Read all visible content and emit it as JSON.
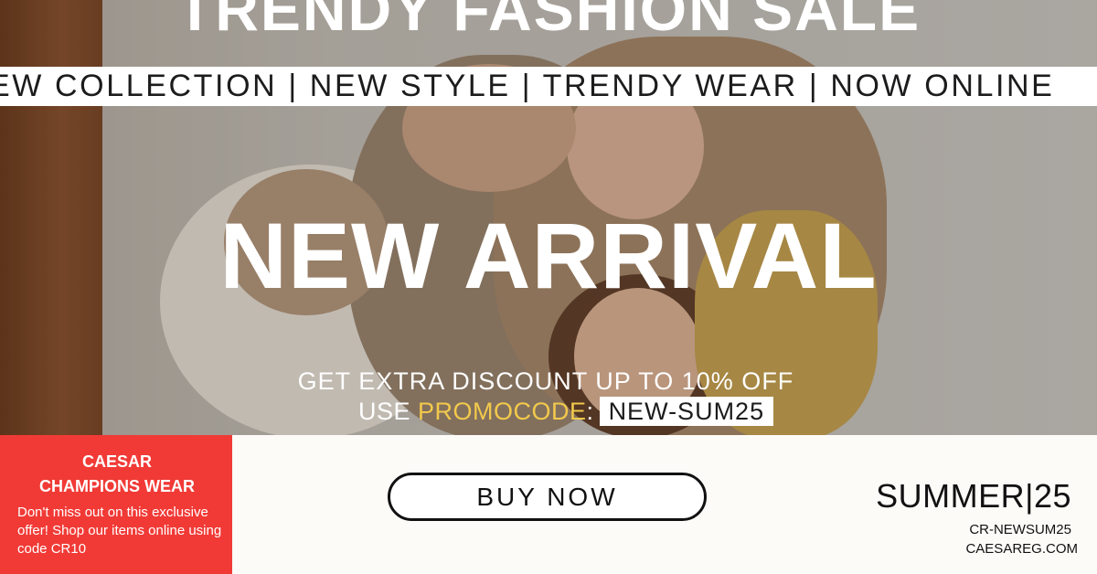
{
  "hero": {
    "top_title": "TRENDY FASHION SALE",
    "ticker": "EW COLLECTION | NEW STYLE | TRENDY WEAR | NOW ONLINE",
    "headline": "NEW ARRIVAL",
    "discount": "GET EXTRA DISCOUNT UP TO 10% OFF",
    "promo_prefix": "USE ",
    "promo_word": "PROMOCODE",
    "promo_colon": ":",
    "promo_code": "NEW-SUM25"
  },
  "brand": {
    "name_line1": "CAESAR",
    "name_line2": "CHAMPIONS WEAR",
    "text": "Don't miss out on this exclusive offer! Shop our items online using code CR10"
  },
  "cta": {
    "label": "BUY NOW"
  },
  "info": {
    "season": "SUMMER|25",
    "code": "CR-NEWSUM25",
    "website": "CAESAREG.COM"
  },
  "colors": {
    "brand_red": "#f13a36",
    "promo_yellow": "#f2c94c",
    "text_dark": "#111111",
    "background": "#fdfbf8"
  }
}
